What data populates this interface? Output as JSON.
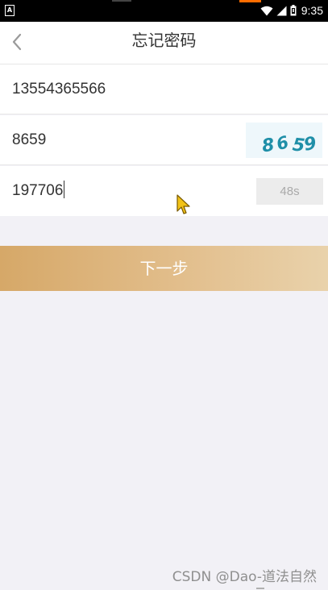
{
  "status_bar": {
    "time": "9:35",
    "left_icon": "A",
    "icons": [
      "wifi-icon",
      "signal-icon",
      "battery-icon"
    ],
    "accent_color": "#ff6d00"
  },
  "nav": {
    "title": "忘记密码",
    "back_icon": "chevron-left-icon"
  },
  "form": {
    "phone_value": "13554365566",
    "captcha_value": "8659",
    "captcha_image_text": [
      "8",
      "6",
      "5",
      "9"
    ],
    "sms_code_value": "197706",
    "countdown_label": "48s"
  },
  "next_button": {
    "label": "下一步",
    "gradient": [
      "#d6a868",
      "#e2be8c",
      "#e9d2ab"
    ]
  },
  "watermark": "CSDN @Dao-道法自然",
  "colors": {
    "background": "#f2f1f6",
    "captcha_text": "#1f8fa8"
  }
}
